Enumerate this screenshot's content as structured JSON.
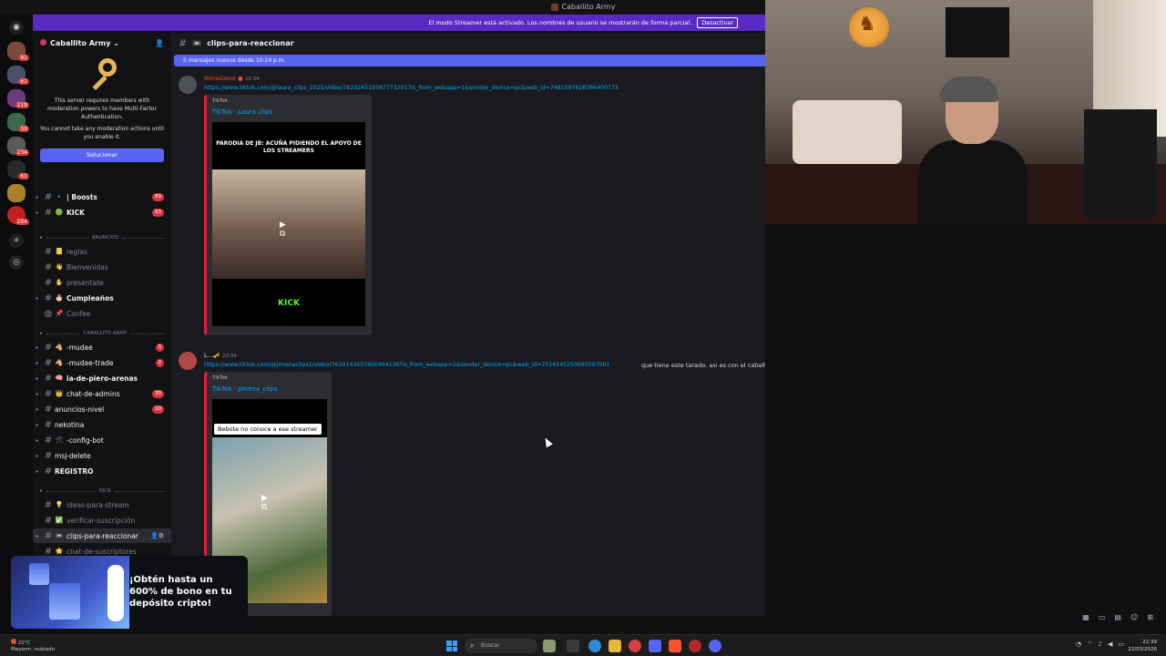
{
  "window": {
    "title": "Caballito Army"
  },
  "streamer_banner": {
    "text": "El modo Streamer está activado. Los nombres de usuario se mostrarán de forma parcial.",
    "button": "Desactivar"
  },
  "server": {
    "name": "Caballito Army",
    "mfa_notice": {
      "line1": "This server requires members with moderation powers to have Multi-Factor Authentication.",
      "line2": "You cannot take any moderation actions until you enable it.",
      "button": "Solucionar"
    }
  },
  "rail_badges": [
    "81",
    "61",
    "219",
    "59",
    "234",
    "61",
    "204"
  ],
  "sidebar": {
    "channels_top": [
      {
        "emoji": "🔹",
        "label": "| Boosts",
        "count": "89"
      },
      {
        "emoji": "🟢",
        "label": "KICK",
        "count": "93"
      }
    ],
    "cat_anuncios": "ANUNCIOS",
    "anuncios": [
      {
        "emoji": "📒",
        "label": "reglas"
      },
      {
        "emoji": "👋",
        "label": "Bienvenidas"
      },
      {
        "emoji": "✋",
        "label": "presentate"
      },
      {
        "emoji": "🎂",
        "label": "Cumpleaños"
      },
      {
        "emoji": "📌",
        "label": "Confee"
      }
    ],
    "cat_army": "CABALLITO ARMY",
    "army": [
      {
        "emoji": "🐴",
        "label": "-mudae",
        "count": "3"
      },
      {
        "emoji": "🐴",
        "label": "-mudae-trade",
        "count": "2"
      },
      {
        "emoji": "🧠",
        "label": "ia-de-piero-arenas",
        "count": ""
      },
      {
        "emoji": "👑",
        "label": "chat-de-admins",
        "count": "30"
      },
      {
        "emoji": "",
        "label": "anuncios-nivel",
        "count": "10"
      },
      {
        "emoji": "",
        "label": "nekotina",
        "count": ""
      },
      {
        "emoji": "🛠",
        "label": "-config-bot",
        "count": ""
      },
      {
        "emoji": "",
        "label": "msj-delete",
        "count": ""
      },
      {
        "emoji": "",
        "label": "REGISTRO",
        "count": ""
      }
    ],
    "cat_kick": "KICK",
    "kick": [
      {
        "emoji": "💡",
        "label": "ideas-para-stream"
      },
      {
        "emoji": "✅",
        "label": "verificar-suscripción"
      },
      {
        "emoji": "📼",
        "label": "clips-para-reaccionar"
      },
      {
        "emoji": "🌟",
        "label": "chat-de-suscriptores"
      }
    ]
  },
  "channel": {
    "emoji": "📼",
    "name": "clips-para-reaccionar"
  },
  "new_messages": "5 mensajes nuevos desde 10:24 p.m.",
  "messages": [
    {
      "author": "RonieDave",
      "time": "22:34",
      "link": "https://www.tiktok.com/@laura_clips_2025/video/7620245193877732017is_from_webapp=1&sender_device=pc&web_id=7481097626366400773",
      "provider": "TikTok",
      "embed_title": "TikTok · Laura clips",
      "thumb_caption": "PARODIA DE JB: ACUÑA PIDIENDO EL APOYO DE LOS STREAMERS",
      "thumb_brand": "KICK"
    },
    {
      "author": "L...🎺",
      "time": "22:34",
      "link": "https://www.tiktok.com/@jimenaclips1/video/7620143557600464136?is_from_webapp=1&sender_device=pc&web_id=7514145250095597061",
      "tail": "que tiene este tarado, asi es con el caballo???",
      "provider": "TikTok",
      "embed_title": "TikTok · Jimena_clips",
      "thumb_label": "Bebote no conoce a ese streamer"
    }
  ],
  "ad": {
    "text": "¡Obtén hasta un 600% de bono en tu depósito cripto!"
  },
  "taskbar": {
    "weather_temp": "21°C",
    "weather_desc": "Mayorm. nublado",
    "search_placeholder": "Buscar",
    "time": "22:39",
    "date": "22/03/2026"
  },
  "colors": {
    "accent": "#5865f2",
    "streamer_bar": "#5a2bc4",
    "link": "#00a8fc",
    "badge": "#da373c"
  }
}
